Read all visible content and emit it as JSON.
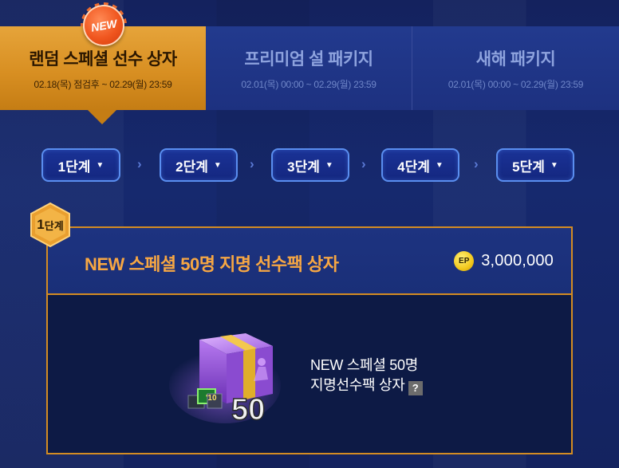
{
  "tabs": [
    {
      "title": "랜덤 스페셜 선수 상자",
      "date": "02.18(목) 점검후 ~ 02.29(월) 23:59",
      "active": true,
      "badge": "NEW"
    },
    {
      "title": "프리미엄 설 패키지",
      "date": "02.01(목) 00:00 ~ 02.29(월) 23:59",
      "active": false
    },
    {
      "title": "새해 패키지",
      "date": "02.01(목) 00:00 ~ 02.29(월) 23:59",
      "active": false
    }
  ],
  "steps": [
    {
      "label": "1단계"
    },
    {
      "label": "2단계"
    },
    {
      "label": "3단계"
    },
    {
      "label": "4단계"
    },
    {
      "label": "5단계"
    }
  ],
  "step_separator": "›",
  "panel": {
    "step_badge_num": "1",
    "step_badge_suffix": "단계",
    "title": "NEW 스페셜 50명 지명 선수팩 상자",
    "currency_icon": "EP",
    "price": "3,000,000",
    "item": {
      "name_line1": "NEW 스페셜 50명",
      "name_line2": "지명선수팩 상자",
      "help": "?",
      "art_label": "50",
      "art_tag": "'10"
    }
  },
  "colors": {
    "active_tab": "#d88f22",
    "inactive_tab": "#1d3180",
    "accent_orange": "#f7a743",
    "step_border": "#5a8ef0",
    "background": "#14225e"
  }
}
